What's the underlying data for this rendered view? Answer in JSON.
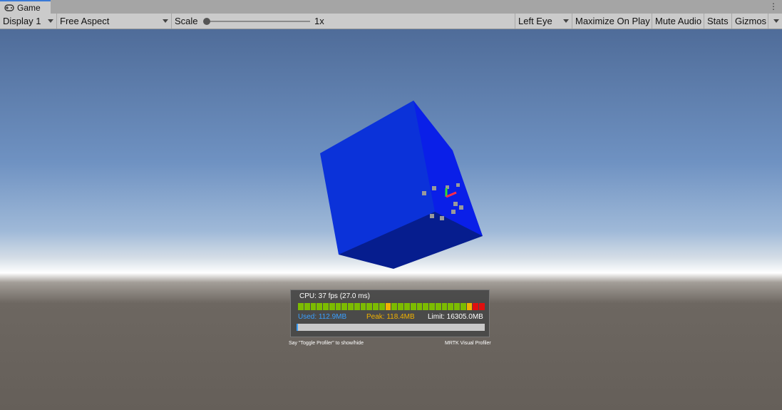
{
  "tab": {
    "label": "Game",
    "icon": "gamepad-icon"
  },
  "toolbar": {
    "display": "Display 1",
    "aspect": "Free Aspect",
    "scale_label": "Scale",
    "scale_value": "1x",
    "eye": "Left Eye",
    "maximize": "Maximize On Play",
    "mute": "Mute Audio",
    "stats": "Stats",
    "gizmos": "Gizmos"
  },
  "profiler": {
    "cpu": "CPU: 37 fps (27.0 ms)",
    "frame_bars": [
      "green",
      "green",
      "green",
      "green",
      "green",
      "green",
      "green",
      "green",
      "green",
      "green",
      "green",
      "green",
      "green",
      "green",
      "orange",
      "green",
      "green",
      "green",
      "green",
      "green",
      "green",
      "green",
      "green",
      "green",
      "green",
      "green",
      "green",
      "orange",
      "red",
      "red"
    ],
    "used": "Used: 112.9MB",
    "peak": "Peak: 118.4MB",
    "limit": "Limit: 16305.0MB",
    "used_fraction": 0.007,
    "hint": "Say \"Toggle Profiler\" to show/hide",
    "brand": "MRTK Visual Profiler"
  },
  "colors": {
    "green": "#7cbc00",
    "orange": "#f2b200",
    "red": "#e01010",
    "cube_front": "#0b32d9",
    "cube_side": "#0a1fe8",
    "cube_bottom": "#061d8e"
  }
}
